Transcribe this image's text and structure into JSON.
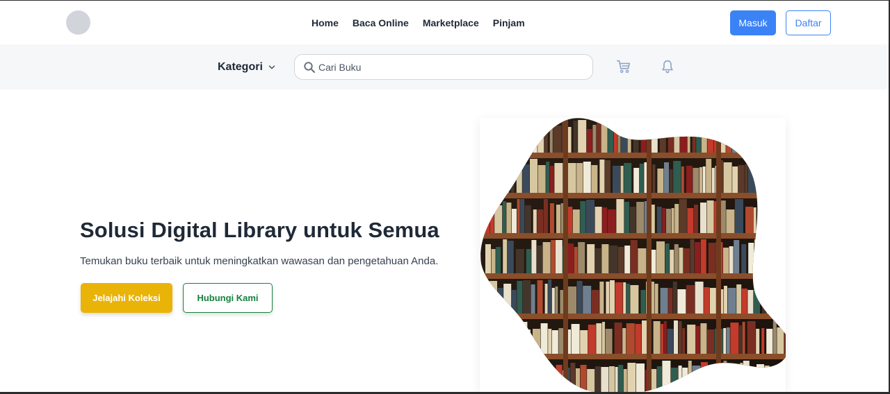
{
  "nav": {
    "links": [
      "Home",
      "Baca Online",
      "Marketplace",
      "Pinjam"
    ],
    "login_label": "Masuk",
    "register_label": "Daftar"
  },
  "subbar": {
    "category_label": "Kategori",
    "search_placeholder": "Cari Buku",
    "search_value": ""
  },
  "hero": {
    "title": "Solusi Digital Library untuk Semua",
    "subtitle": "Temukan buku terbaik untuk meningkatkan wawasan dan pengetahuan Anda.",
    "primary_button": "Jelajahi Koleksi",
    "secondary_button": "Hubungi Kami"
  },
  "icons": {
    "search": "search-icon",
    "cart": "cart-icon",
    "bell": "bell-icon",
    "chevron": "chevron-down-icon"
  },
  "colors": {
    "primary_blue": "#3b82f6",
    "accent_yellow": "#eab308",
    "accent_green": "#15803d",
    "subbar_bg": "#f6f7f9"
  }
}
